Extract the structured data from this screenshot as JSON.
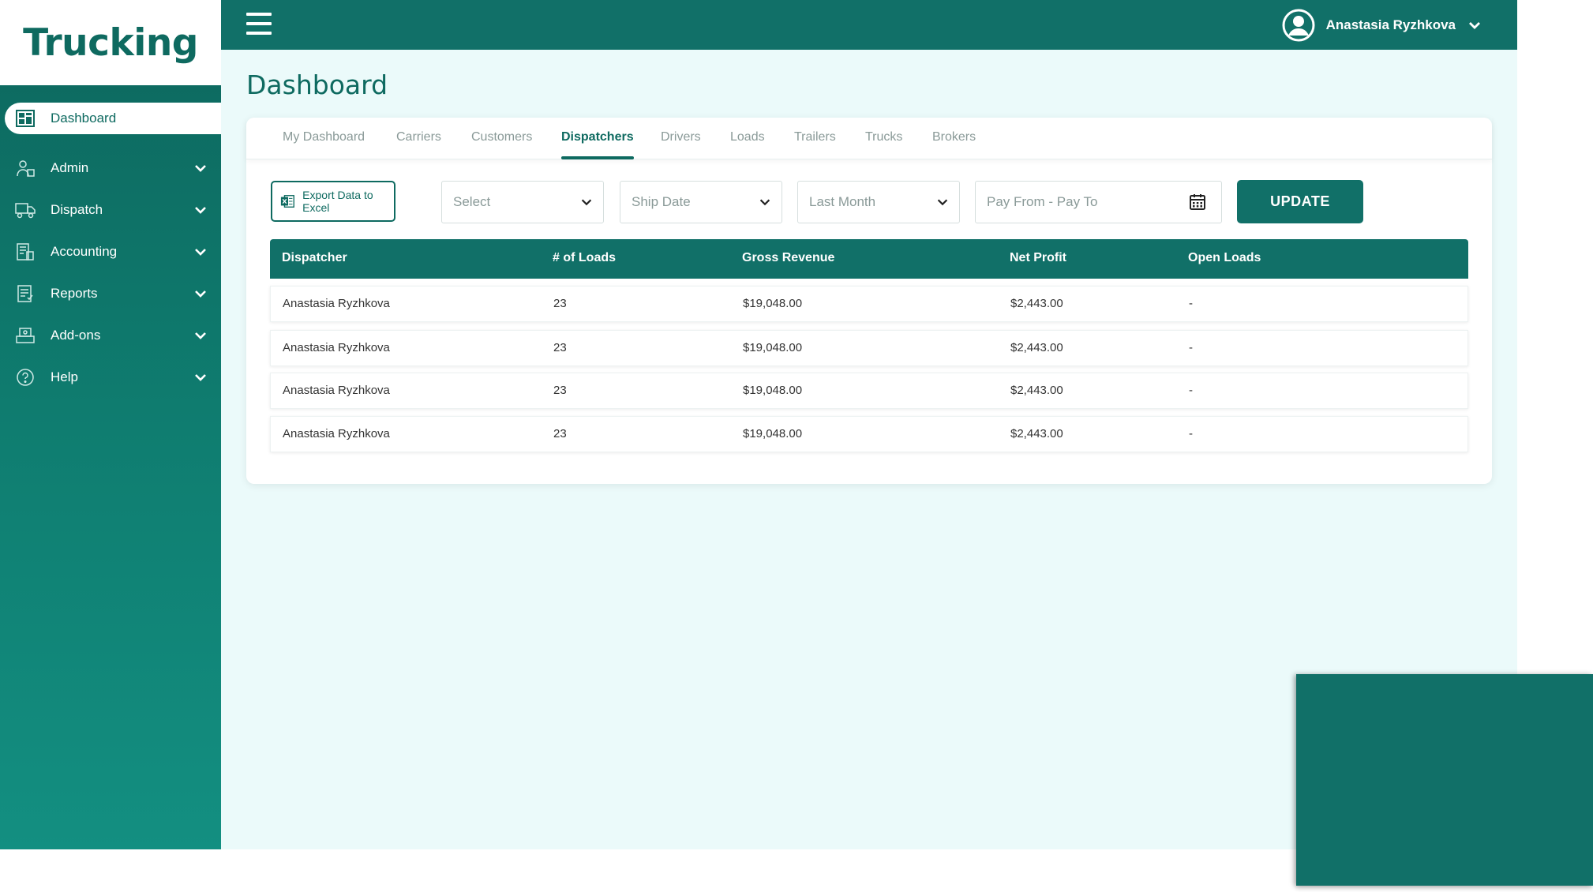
{
  "app": {
    "logo_text": "Trucking"
  },
  "topbar": {
    "user_name": "Anastasia Ryzhkova"
  },
  "sidebar": {
    "items": [
      {
        "label": "Dashboard",
        "icon": "dashboard-icon",
        "active": true
      },
      {
        "label": "Admin",
        "icon": "admin-icon"
      },
      {
        "label": "Dispatch",
        "icon": "truck-icon"
      },
      {
        "label": "Accounting",
        "icon": "accounting-icon"
      },
      {
        "label": "Reports",
        "icon": "reports-icon"
      },
      {
        "label": "Add-ons",
        "icon": "addons-icon"
      },
      {
        "label": "Help",
        "icon": "help-icon"
      }
    ]
  },
  "page": {
    "title": "Dashboard"
  },
  "tabs": [
    {
      "label": "My Dashboard"
    },
    {
      "label": "Carriers"
    },
    {
      "label": "Customers"
    },
    {
      "label": "Dispatchers",
      "active": true
    },
    {
      "label": "Drivers"
    },
    {
      "label": "Loads"
    },
    {
      "label": "Trailers"
    },
    {
      "label": "Trucks"
    },
    {
      "label": "Brokers"
    }
  ],
  "filters": {
    "export_label": "Export Data to Excel",
    "select_placeholder": "Select",
    "date_type": "Ship Date",
    "period": "Last Month",
    "pay_range_placeholder": "Pay From - Pay To",
    "update_label": "UPDATE"
  },
  "table": {
    "headers": [
      "Dispatcher",
      "# of Loads",
      "Gross Revenue",
      "Net Profit",
      "Open Loads"
    ],
    "rows": [
      {
        "dispatcher": "Anastasia Ryzhkova",
        "loads": "23",
        "gross": "$19,048.00",
        "net": "$2,443.00",
        "open": "-"
      },
      {
        "dispatcher": "Anastasia Ryzhkova",
        "loads": "23",
        "gross": "$19,048.00",
        "net": "$2,443.00",
        "open": "-"
      },
      {
        "dispatcher": "Anastasia Ryzhkova",
        "loads": "23",
        "gross": "$19,048.00",
        "net": "$2,443.00",
        "open": "-"
      },
      {
        "dispatcher": "Anastasia Ryzhkova",
        "loads": "23",
        "gross": "$19,048.00",
        "net": "$2,443.00",
        "open": "-"
      }
    ]
  },
  "colors": {
    "primary": "#117068",
    "background": "#ebfafa",
    "accent_text": "#0e6a60"
  }
}
